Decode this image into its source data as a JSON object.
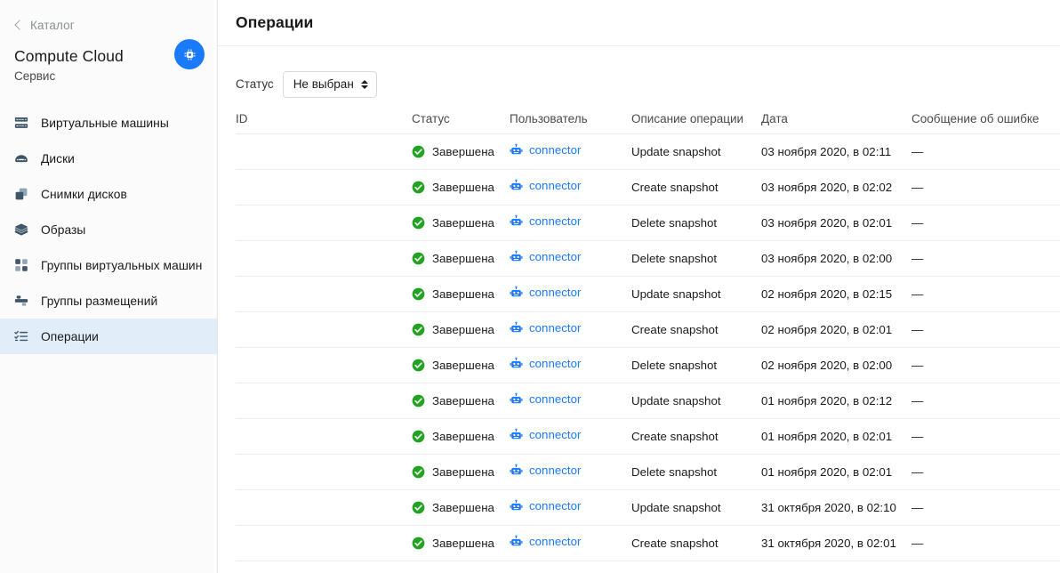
{
  "sidebar": {
    "breadcrumb": {
      "icon": "chevron-left-icon",
      "label": "Каталог"
    },
    "service": {
      "title": "Compute Cloud",
      "subtitle": "Сервис",
      "avatar_icon": "cpu-chip-icon",
      "avatar_color": "#1a7afc"
    },
    "items": [
      {
        "label": "Виртуальные машины",
        "icon": "server-icon",
        "active": false
      },
      {
        "label": "Диски",
        "icon": "disk-icon",
        "active": false
      },
      {
        "label": "Снимки дисков",
        "icon": "snapshot-icon",
        "active": false
      },
      {
        "label": "Образы",
        "icon": "layers-icon",
        "active": false
      },
      {
        "label": "Группы виртуальных машин",
        "icon": "vm-group-icon",
        "active": false
      },
      {
        "label": "Группы размещений",
        "icon": "placement-group-icon",
        "active": false
      },
      {
        "label": "Операции",
        "icon": "operations-icon",
        "active": true
      }
    ]
  },
  "header": {
    "title": "Операции"
  },
  "filter": {
    "label": "Статус",
    "select": {
      "value": "Не выбран",
      "icon": "updown-arrows-icon",
      "options": [
        "Не выбран"
      ]
    }
  },
  "table": {
    "columns": [
      {
        "key": "id",
        "label": "ID"
      },
      {
        "key": "status",
        "label": "Статус"
      },
      {
        "key": "user",
        "label": "Пользователь"
      },
      {
        "key": "desc",
        "label": "Описание операции"
      },
      {
        "key": "date",
        "label": "Дата"
      },
      {
        "key": "error",
        "label": "Сообщение об ошибке"
      }
    ],
    "status_icon": "check-circle-icon",
    "status_color": "#22a323",
    "user_icon": "robot-icon",
    "user_link_color": "#1a7afc",
    "rows": [
      {
        "id": "",
        "status": "Завершена",
        "user": "connector",
        "desc": "Update snapshot",
        "date": "03 ноября 2020, в 02:11",
        "error": "—"
      },
      {
        "id": "",
        "status": "Завершена",
        "user": "connector",
        "desc": "Create snapshot",
        "date": "03 ноября 2020, в 02:02",
        "error": "—"
      },
      {
        "id": "",
        "status": "Завершена",
        "user": "connector",
        "desc": "Delete snapshot",
        "date": "03 ноября 2020, в 02:01",
        "error": "—"
      },
      {
        "id": "",
        "status": "Завершена",
        "user": "connector",
        "desc": "Delete snapshot",
        "date": "03 ноября 2020, в 02:00",
        "error": "—"
      },
      {
        "id": "",
        "status": "Завершена",
        "user": "connector",
        "desc": "Update snapshot",
        "date": "02 ноября 2020, в 02:15",
        "error": "—"
      },
      {
        "id": "",
        "status": "Завершена",
        "user": "connector",
        "desc": "Create snapshot",
        "date": "02 ноября 2020, в 02:01",
        "error": "—"
      },
      {
        "id": "",
        "status": "Завершена",
        "user": "connector",
        "desc": "Delete snapshot",
        "date": "02 ноября 2020, в 02:00",
        "error": "—"
      },
      {
        "id": "",
        "status": "Завершена",
        "user": "connector",
        "desc": "Update snapshot",
        "date": "01 ноября 2020, в 02:12",
        "error": "—"
      },
      {
        "id": "",
        "status": "Завершена",
        "user": "connector",
        "desc": "Create snapshot",
        "date": "01 ноября 2020, в 02:01",
        "error": "—"
      },
      {
        "id": "",
        "status": "Завершена",
        "user": "connector",
        "desc": "Delete snapshot",
        "date": "01 ноября 2020, в 02:01",
        "error": "—"
      },
      {
        "id": "",
        "status": "Завершена",
        "user": "connector",
        "desc": "Update snapshot",
        "date": "31 октября 2020, в 02:10",
        "error": "—"
      },
      {
        "id": "",
        "status": "Завершена",
        "user": "connector",
        "desc": "Create snapshot",
        "date": "31 октября 2020, в 02:01",
        "error": "—"
      }
    ]
  }
}
